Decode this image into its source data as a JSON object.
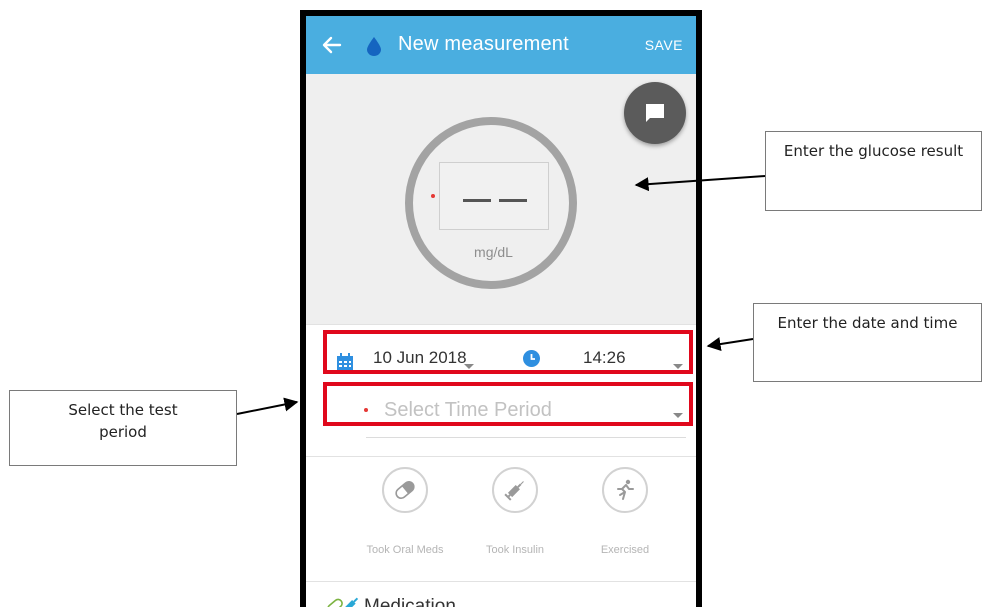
{
  "app_bar": {
    "back_icon": "arrow-left-icon",
    "drop_icon": "water-drop-icon",
    "title": "New measurement",
    "save_label": "SAVE",
    "bar_color": "#4aaee0"
  },
  "note_button_icon": "comment-icon",
  "glucose": {
    "value": "— —",
    "unit": "mg/dL"
  },
  "date_time": {
    "calendar_icon": "calendar-icon",
    "date": "10 Jun 2018",
    "clock_icon": "clock-icon",
    "time": "14:26"
  },
  "time_period": {
    "placeholder": "Select Time Period"
  },
  "activities": [
    {
      "icon": "pill-icon",
      "label": "Took Oral Meds"
    },
    {
      "icon": "syringe-icon",
      "label": "Took Insulin"
    },
    {
      "icon": "running-icon",
      "label": "Exercised"
    }
  ],
  "medication": {
    "icon": "medication-icon",
    "label": "Medication"
  },
  "annotations": {
    "glucose": "Enter the glucose result",
    "date_time": "Enter the date and time",
    "period": "Select the test period",
    "highlight_color": "#e0081c"
  }
}
